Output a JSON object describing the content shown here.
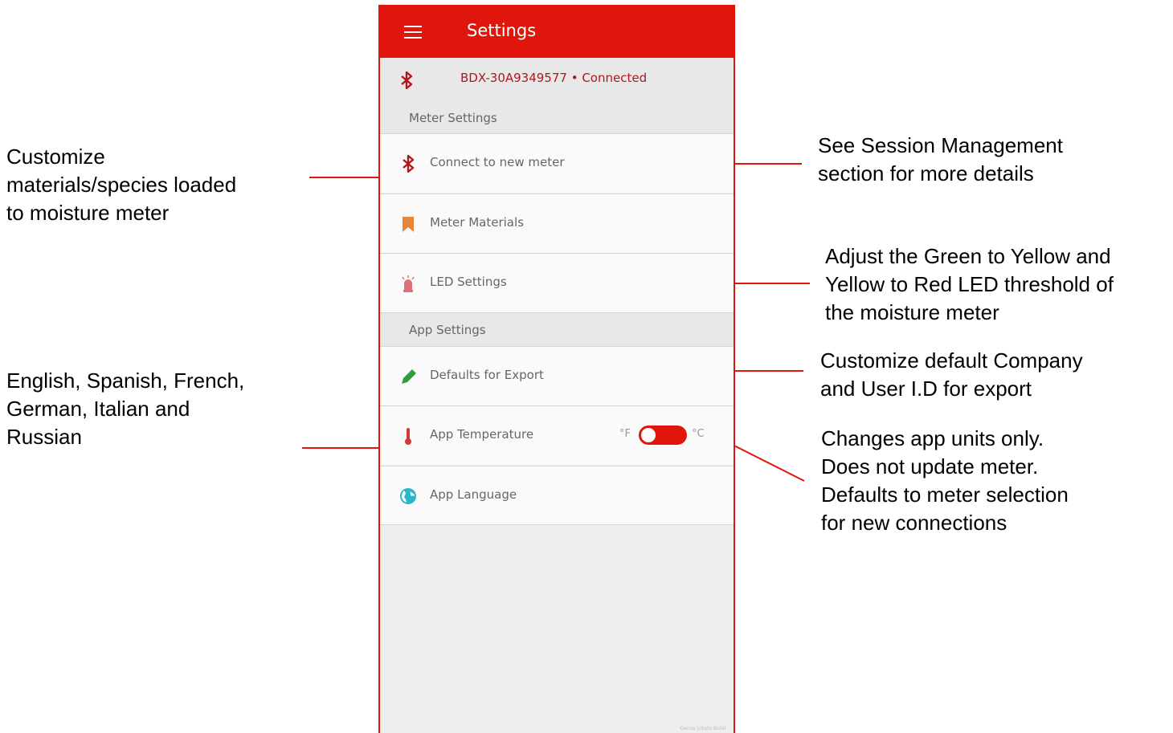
{
  "app": {
    "title": "Settings",
    "connection_status": "BDX-30A9349577 • Connected",
    "build_tag": "Genus jcbotx Build"
  },
  "sections": {
    "meter_settings": "Meter Settings",
    "app_settings": "App Settings"
  },
  "items": {
    "connect_new_meter": "Connect to new meter",
    "meter_materials": "Meter Materials",
    "led_settings": "LED Settings",
    "defaults_export": "Defaults for Export",
    "app_temperature": "App Temperature",
    "app_language": "App Language"
  },
  "temperature_toggle": {
    "unit_f": "°F",
    "unit_c": "°C",
    "selected": "°F"
  },
  "annotations": {
    "materials": "Customize\nmaterials/species loaded\nto moisture meter",
    "language": "English, Spanish, French,\nGerman, Italian and\nRussian",
    "session": "See Session Management\nsection for more details",
    "led": "Adjust the Green to Yellow and\nYellow to Red LED threshold of\nthe moisture meter",
    "export": "Customize default Company\nand User I.D for export",
    "units": "Changes app units only.\nDoes not update meter.\nDefaults to meter selection\nfor new connections"
  },
  "colors": {
    "brand_red": "#e0160c",
    "status_text": "#b0171b",
    "materials_icon": "#e8873a",
    "led_icon": "#e0707a",
    "export_icon": "#2e9e3c",
    "thermometer_icon": "#d23a3a",
    "globe_icon": "#29b6c8"
  },
  "icons": {
    "menu": "menu-icon",
    "status_bluetooth": "bluetooth-icon",
    "connect": "bluetooth-icon",
    "materials": "bookmark-icon",
    "led": "led-alarm-icon",
    "export": "pencil-icon",
    "temperature": "thermometer-icon",
    "language": "globe-icon"
  }
}
